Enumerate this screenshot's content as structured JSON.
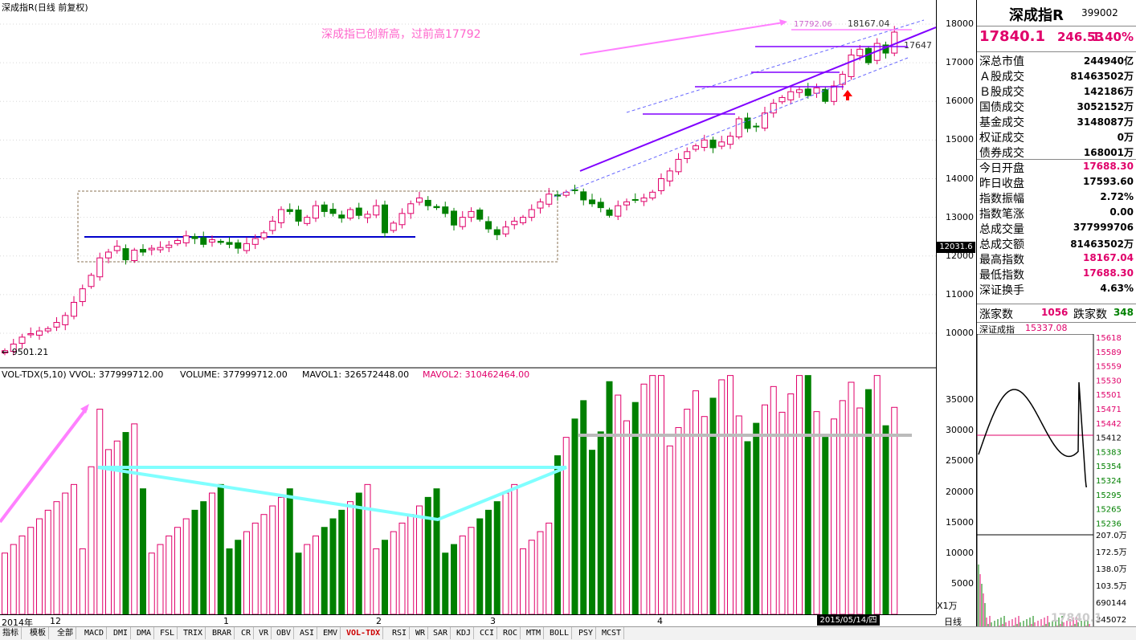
{
  "chart_title": "深成指R(日线 前复权)",
  "annotation": "深成指已创新高，过前高17792",
  "price_marks": {
    "low_label": "9501.21",
    "prev_high": "17792.06",
    "high": "18167.04",
    "last": "17647",
    "cursor": "12031.6"
  },
  "indicator_header": {
    "name": "VOL-TDX(5,10)",
    "vvol": "VVOL: 377999712.00",
    "volume": "VOLUME: 377999712.00",
    "mavol1": "MAVOL1: 326572448.00",
    "mavol2": "MAVOL2: 310462464.00"
  },
  "colors": {
    "up": "#e0006a",
    "down": "#008000",
    "ma_line": "#000000",
    "trend": "#8000ff",
    "pink_arrow": "#ff80ff",
    "cyan_line": "#80ffff"
  },
  "chart_data": [
    {
      "type": "candlestick",
      "title": "深成指R(日线 前复权)",
      "y_ticks": [
        "18000",
        "17000",
        "16000",
        "15000",
        "14000",
        "13000",
        "12000",
        "11000",
        "10000"
      ],
      "ylim": [
        9300,
        18400
      ],
      "x_ticks": [
        "2014年",
        "12",
        "1",
        "2",
        "3",
        "4"
      ],
      "n_bars": 104,
      "closes": [
        9550,
        9720,
        9900,
        9990,
        10060,
        10120,
        10280,
        10460,
        10800,
        11150,
        11500,
        11950,
        12100,
        12250,
        11900,
        12150,
        12100,
        12200,
        12220,
        12280,
        12400,
        12520,
        12450,
        12300,
        12420,
        12350,
        12300,
        12200,
        12320,
        12450,
        12600,
        12900,
        13200,
        13150,
        12900,
        13000,
        13300,
        13150,
        13100,
        12980,
        13200,
        13050,
        13080,
        13300,
        12600,
        12850,
        13100,
        13350,
        13500,
        13300,
        13250,
        13100,
        12800,
        13000,
        13150,
        12950,
        12700,
        12550,
        12750,
        12900,
        13000,
        13200,
        13400,
        13600,
        13550,
        13650,
        13700,
        13450,
        13350,
        13250,
        13050,
        13300,
        13400,
        13450,
        13500,
        13650,
        14000,
        14200,
        14500,
        14700,
        14850,
        15000,
        14800,
        14950,
        15100,
        15550,
        15300,
        15350,
        15700,
        15950,
        16100,
        16250,
        16300,
        16150,
        16350,
        16000,
        16400,
        16700,
        17200,
        17350,
        17000,
        17500,
        17250,
        17792
      ]
    },
    {
      "type": "bar",
      "title": "VOL-TDX(5,10)",
      "y_ticks": [
        "35000",
        "30000",
        "25000",
        "20000",
        "15000",
        "10000",
        "5000"
      ],
      "unit": "X1万",
      "ylim": [
        0,
        40000
      ]
    }
  ],
  "yaxis_unit": "X1万",
  "x_date": "2015/05/14/四",
  "toolbar": [
    "指标",
    "模板",
    "全部",
    "MACD",
    "DMI",
    "DMA",
    "FSL",
    "TRIX",
    "BRAR",
    "CR",
    "VR",
    "OBV",
    "ASI",
    "EMV",
    "VOL-TDX",
    "RSI",
    "WR",
    "SAR",
    "KDJ",
    "CCI",
    "ROC",
    "MTM",
    "BOLL",
    "PSY",
    "MCST"
  ],
  "toolbar_active": "VOL-TDX",
  "xaxis_right": "日线",
  "panel": {
    "name": "深成指R",
    "code": "399002",
    "price": "17840.1",
    "change": "246.53",
    "pct": "1.40%",
    "rows": [
      {
        "k": "深总市值",
        "v": "244940亿",
        "c": ""
      },
      {
        "k": "Ａ股成交",
        "v": "81463502万",
        "c": ""
      },
      {
        "k": "Ｂ股成交",
        "v": "142186万",
        "c": ""
      },
      {
        "k": "国债成交",
        "v": "3052152万",
        "c": ""
      },
      {
        "k": "基金成交",
        "v": "3148087万",
        "c": ""
      },
      {
        "k": "权证成交",
        "v": "0万",
        "c": ""
      },
      {
        "k": "债券成交",
        "v": "168001万",
        "c": ""
      },
      {
        "k": "今日开盘",
        "v": "17688.30",
        "c": "red"
      },
      {
        "k": "昨日收盘",
        "v": "17593.60",
        "c": ""
      },
      {
        "k": "指数振幅",
        "v": "2.72%",
        "c": ""
      },
      {
        "k": "指数笔涨",
        "v": "0.00",
        "c": ""
      },
      {
        "k": "总成交量",
        "v": "377999706",
        "c": ""
      },
      {
        "k": "总成交额",
        "v": "81463502万",
        "c": ""
      },
      {
        "k": "最高指数",
        "v": "18167.04",
        "c": "red"
      },
      {
        "k": "最低指数",
        "v": "17688.30",
        "c": "red"
      },
      {
        "k": "深证换手",
        "v": "4.63%",
        "c": ""
      }
    ],
    "adv_label": "涨家数",
    "adv": "1056",
    "dec_label": "跌家数",
    "dec": "348",
    "mini_title": "深证成指",
    "mini_value": "15337.08",
    "mini_ticks": [
      "15618",
      "15589",
      "15559",
      "15530",
      "15501",
      "15471",
      "15442",
      "15412",
      "15383",
      "15354",
      "15324",
      "15295",
      "15265",
      "15236"
    ],
    "mini_vol_ticks": [
      "207.0万",
      "172.5万",
      "138.0万",
      "103.5万",
      "690144",
      "345072"
    ],
    "watermark": "17840.1"
  }
}
